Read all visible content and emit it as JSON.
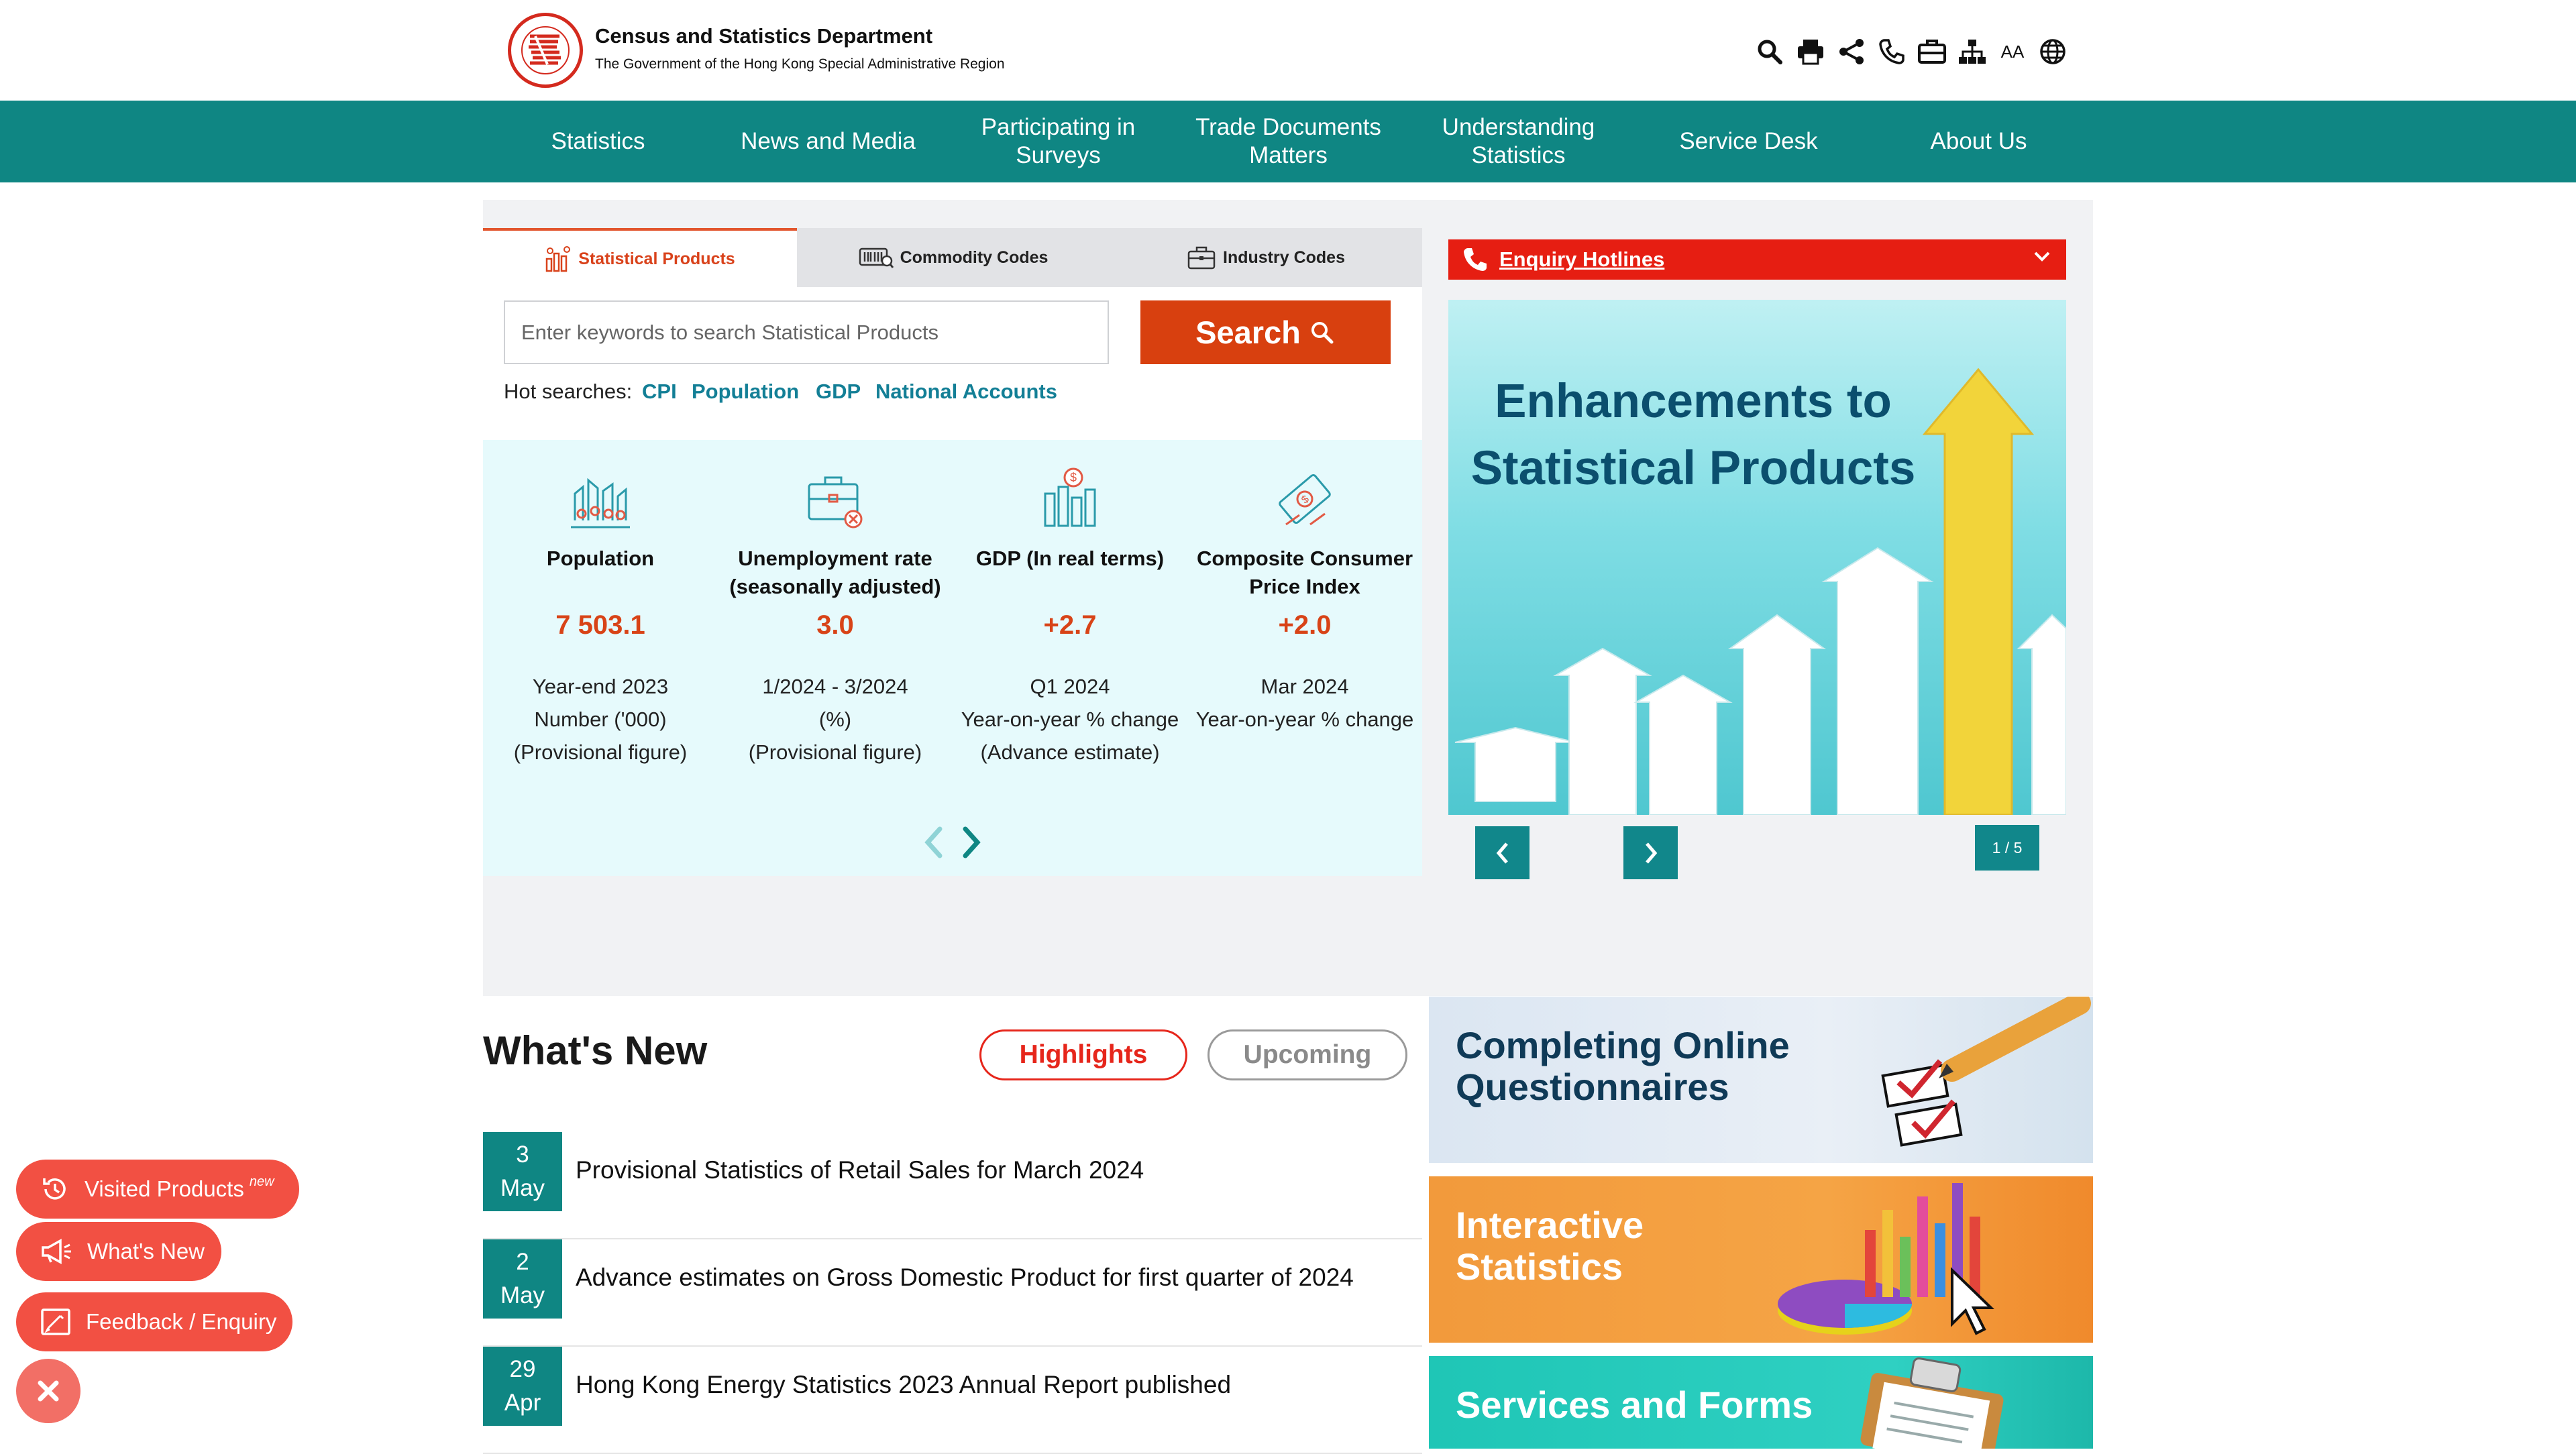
{
  "header": {
    "dept_name": "Census and Statistics Department",
    "dept_sub": "The Government of the Hong Kong Special Administrative Region",
    "tools": [
      "search-icon",
      "print-icon",
      "share-icon",
      "phone-icon",
      "briefcase-icon",
      "sitemap-icon",
      "font-size-icon",
      "globe-icon"
    ],
    "font_size_label": "AA"
  },
  "nav": {
    "items": [
      {
        "label": "Statistics"
      },
      {
        "label": "News and Media"
      },
      {
        "label": "Participating in Surveys"
      },
      {
        "label": "Trade Documents Matters"
      },
      {
        "label": "Understanding Statistics"
      },
      {
        "label": "Service Desk"
      },
      {
        "label": "About Us"
      }
    ]
  },
  "tabs": [
    {
      "label": "Statistical Products",
      "icon": "bar-chart-icon",
      "active": true
    },
    {
      "label": "Commodity Codes",
      "icon": "barcode-icon",
      "active": false
    },
    {
      "label": "Industry Codes",
      "icon": "briefcase-icon",
      "active": false
    }
  ],
  "search": {
    "placeholder": "Enter keywords to search Statistical Products",
    "button_label": "Search",
    "hot_label": "Hot searches:",
    "hot_links": [
      "CPI",
      "Population",
      "GDP",
      "National Accounts"
    ]
  },
  "key_stats": [
    {
      "icon": "population-icon",
      "name": "Population",
      "value": "7 503.1",
      "desc": [
        "Year-end 2023",
        "Number ('000)",
        "(Provisional figure)"
      ]
    },
    {
      "icon": "unemployment-icon",
      "name": "Unemployment rate (seasonally adjusted)",
      "value": "3.0",
      "desc": [
        "1/2024 - 3/2024",
        "(%)",
        "(Provisional figure)"
      ]
    },
    {
      "icon": "gdp-icon",
      "name": "GDP (In real terms)",
      "value": "+2.7",
      "desc": [
        "Q1 2024",
        "Year-on-year % change",
        "(Advance estimate)"
      ]
    },
    {
      "icon": "cpi-icon",
      "name": "Composite Consumer Price Index",
      "value": "+2.0",
      "desc": [
        "Mar 2024",
        "Year-on-year % change"
      ]
    }
  ],
  "enquiry": {
    "label": "Enquiry Hotlines"
  },
  "banner": {
    "title": "Enhancements to Statistical Products",
    "counter": "1 / 5"
  },
  "whats_new": {
    "title": "What's New",
    "tabs": [
      "Highlights",
      "Upcoming"
    ],
    "items": [
      {
        "day": "3",
        "month": "May",
        "text": "Provisional Statistics of Retail Sales for March 2024"
      },
      {
        "day": "2",
        "month": "May",
        "text": "Advance estimates on Gross Domestic Product for first quarter of 2024"
      },
      {
        "day": "29",
        "month": "Apr",
        "text": "Hong Kong Energy Statistics 2023 Annual Report published"
      }
    ]
  },
  "promos": [
    {
      "title": "Completing Online Questionnaires",
      "color": "#0f3a57"
    },
    {
      "title": "Interactive Statistics",
      "color": "#ffffff"
    },
    {
      "title": "Services and Forms",
      "color": "#ffffff"
    }
  ],
  "floating": {
    "visited": "Visited Products",
    "visited_badge": "new",
    "whats_new": "What's New",
    "feedback": "Feedback / Enquiry"
  },
  "colors": {
    "teal": "#0f8683",
    "accent_orange": "#d8400f",
    "red": "#e61e12"
  }
}
